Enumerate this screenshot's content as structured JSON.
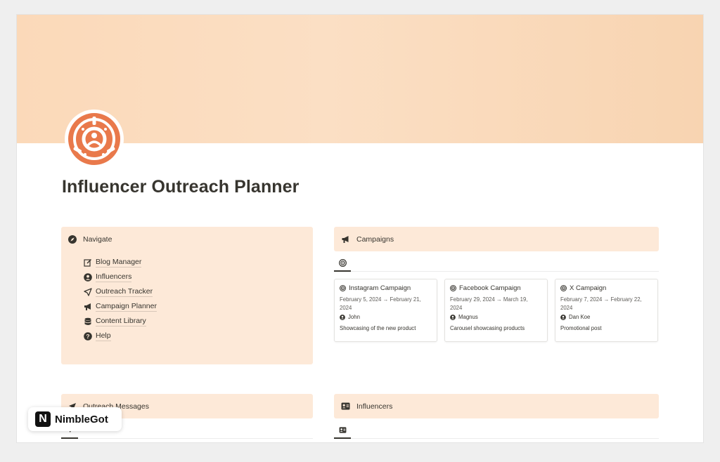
{
  "page": {
    "title": "Influencer Outreach Planner",
    "icon": "people-circle-icon",
    "cover_color": "#fbdcbe",
    "accent_color": "#e9794b"
  },
  "navigate": {
    "heading": "Navigate",
    "heading_icon": "compass-icon",
    "items": [
      {
        "label": "Blog Manager",
        "icon": "edit-icon"
      },
      {
        "label": "Influencers",
        "icon": "person-circle-icon"
      },
      {
        "label": "Outreach Tracker",
        "icon": "send-icon"
      },
      {
        "label": "Campaign Planner",
        "icon": "megaphone-icon"
      },
      {
        "label": "Content Library",
        "icon": "database-icon"
      },
      {
        "label": "Help",
        "icon": "help-icon"
      }
    ]
  },
  "campaigns": {
    "heading": "Campaigns",
    "heading_icon": "megaphone-icon",
    "view_icon": "target-icon",
    "cards": [
      {
        "title": "Instagram Campaign",
        "date_line1": "February 5, 2024 → February 21,",
        "date_line2": "2024",
        "person": "John",
        "description": "Showcasing of the new product"
      },
      {
        "title": "Facebook Campaign",
        "date_line1": "February 29, 2024 → March 19,",
        "date_line2": "2024",
        "person": "Magnus",
        "description": "Carousel showcasing products"
      },
      {
        "title": "X Campaign",
        "date_line1": "February 7, 2024 → February 22,",
        "date_line2": "2024",
        "person": "Dan Koe",
        "description": "Promotional post"
      }
    ]
  },
  "outreach_messages": {
    "heading": "Outreach Messages",
    "heading_icon": "send-icon"
  },
  "influencers": {
    "heading": "Influencers",
    "heading_icon": "contact-card-icon"
  },
  "watermark": {
    "logo_letter": "N",
    "text": "NimbleGot"
  }
}
